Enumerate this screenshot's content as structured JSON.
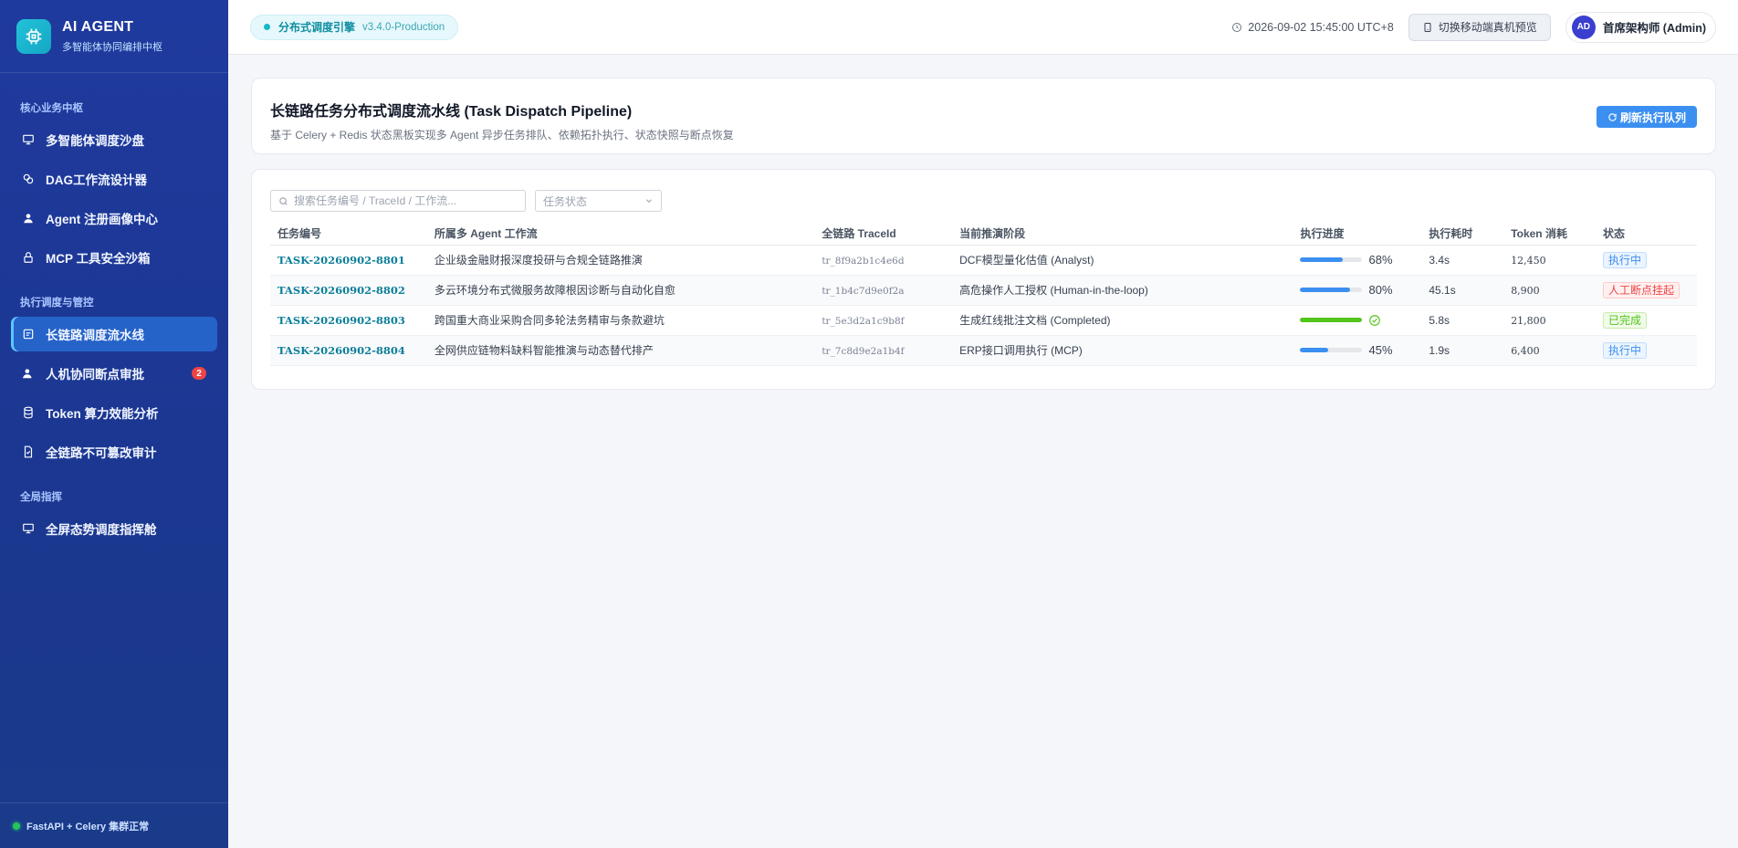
{
  "brand": {
    "title": "AI AGENT",
    "subtitle": "多智能体协同编排中枢"
  },
  "sidebar": {
    "sections": [
      {
        "heading": "核心业务中枢",
        "items": [
          {
            "label": "多智能体调度沙盘",
            "icon": "monitor-icon"
          },
          {
            "label": "DAG工作流设计器",
            "icon": "layers-icon"
          },
          {
            "label": "Agent 注册画像中心",
            "icon": "user-icon"
          },
          {
            "label": "MCP 工具安全沙箱",
            "icon": "lock-icon"
          }
        ]
      },
      {
        "heading": "执行调度与管控",
        "items": [
          {
            "label": "长链路调度流水线",
            "icon": "pipeline-icon",
            "active": true
          },
          {
            "label": "人机协同断点审批",
            "icon": "user-check-icon",
            "badge": "2"
          },
          {
            "label": "Token 算力效能分析",
            "icon": "database-icon"
          },
          {
            "label": "全链路不可篡改审计",
            "icon": "file-icon"
          }
        ]
      },
      {
        "heading": "全局指挥",
        "items": [
          {
            "label": "全屏态势调度指挥舱",
            "icon": "screen-icon"
          }
        ]
      }
    ],
    "footer": "FastAPI + Celery 集群正常"
  },
  "header": {
    "engine_name": "分布式调度引擎",
    "engine_version": "v3.4.0-Production",
    "datetime": "2026-09-02 15:45:00 UTC+8",
    "mobile_preview_label": "切换移动端真机预览",
    "user_initials": "AD",
    "user_name": "首席架构师 (Admin)"
  },
  "page": {
    "title": "长链路任务分布式调度流水线 (Task Dispatch Pipeline)",
    "subtitle": "基于 Celery + Redis 状态黑板实现多 Agent 异步任务排队、依赖拓扑执行、状态快照与断点恢复",
    "refresh_label": "刷新执行队列"
  },
  "filters": {
    "search_placeholder": "搜索任务编号 / TraceId / 工作流...",
    "status_placeholder": "任务状态"
  },
  "table": {
    "columns": [
      "任务编号",
      "所属多 Agent 工作流",
      "全链路 TraceId",
      "当前推演阶段",
      "执行进度",
      "执行耗时",
      "Token 消耗",
      "状态"
    ],
    "rows": [
      {
        "id": "TASK-20260902-8801",
        "workflow": "企业级金融财报深度投研与合规全链路推演",
        "trace": "tr_8f9a2b1c4e6d",
        "stage": "DCF模型量化估值 (Analyst)",
        "progress": 68,
        "progress_label": "68%",
        "duration": "3.4s",
        "tokens": "12,450",
        "status": "执行中",
        "status_color": "blue"
      },
      {
        "id": "TASK-20260902-8802",
        "workflow": "多云环境分布式微服务故障根因诊断与自动化自愈",
        "trace": "tr_1b4c7d9e0f2a",
        "stage": "高危操作人工授权 (Human-in-the-loop)",
        "progress": 80,
        "progress_label": "80%",
        "duration": "45.1s",
        "tokens": "8,900",
        "status": "人工断点挂起",
        "status_color": "red"
      },
      {
        "id": "TASK-20260902-8803",
        "workflow": "跨国重大商业采购合同多轮法务精审与条款避坑",
        "trace": "tr_5e3d2a1c9b8f",
        "stage": "生成红线批注文档 (Completed)",
        "progress": 100,
        "progress_label": "",
        "duration": "5.8s",
        "tokens": "21,800",
        "status": "已完成",
        "status_color": "green"
      },
      {
        "id": "TASK-20260902-8804",
        "workflow": "全网供应链物料缺料智能推演与动态替代排产",
        "trace": "tr_7c8d9e2a1b4f",
        "stage": "ERP接口调用执行 (MCP)",
        "progress": 45,
        "progress_label": "45%",
        "duration": "1.9s",
        "tokens": "6,400",
        "status": "执行中",
        "status_color": "blue"
      }
    ]
  }
}
